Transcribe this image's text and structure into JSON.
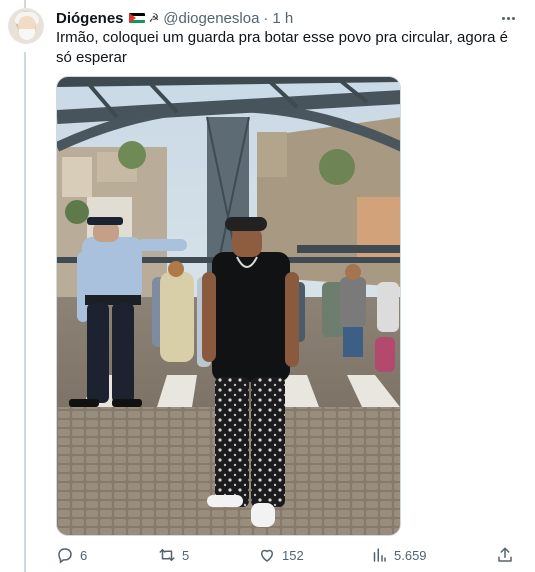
{
  "tweet": {
    "author_name": "Diógenes",
    "handle": "@diogenesloa",
    "separator": "·",
    "time": "1 h",
    "text": "Irmão, coloquei um guarda pra botar esse povo pra circular, agora é só esperar",
    "hammer_symbol": "☭"
  },
  "icons": {
    "flag": "palestine-flag-icon",
    "hammer": "hammer-sickle-icon",
    "more": "more-options-icon",
    "reply": "reply-icon",
    "retweet": "retweet-icon",
    "like": "heart-icon",
    "views": "views-icon",
    "share": "share-icon"
  },
  "actions": {
    "replies": "6",
    "retweets": "5",
    "likes": "152",
    "views": "5.659"
  },
  "colors": {
    "text_primary": "#0f1419",
    "text_secondary": "#536471",
    "border": "#cfd9de"
  }
}
